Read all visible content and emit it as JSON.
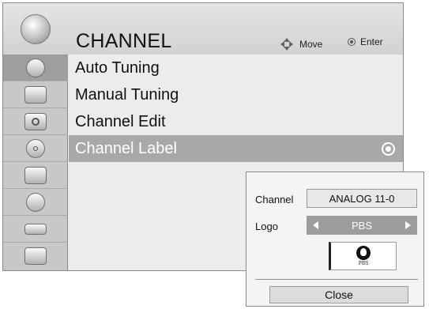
{
  "header": {
    "title": "CHANNEL",
    "logo_icon": "satellite-dish-icon",
    "hints": {
      "move_label": "Move",
      "enter_label": "Enter"
    }
  },
  "sidebar": {
    "items": [
      {
        "icon": "satellite-dish-icon",
        "active": true
      },
      {
        "icon": "tv-screen-icon"
      },
      {
        "icon": "speaker-icon"
      },
      {
        "icon": "clock-icon"
      },
      {
        "icon": "briefcase-icon"
      },
      {
        "icon": "padlock-icon"
      },
      {
        "icon": "cable-plug-icon"
      },
      {
        "icon": "photo-folder-icon"
      }
    ]
  },
  "menu": {
    "items": [
      {
        "label": "Auto Tuning"
      },
      {
        "label": "Manual Tuning"
      },
      {
        "label": "Channel Edit"
      },
      {
        "label": "Channel Label",
        "selected": true
      }
    ]
  },
  "popup": {
    "channel_label": "Channel",
    "channel_value": "ANALOG 11-0",
    "logo_label": "Logo",
    "logo_value": "PBS",
    "logo_preview_text": "PBS",
    "close_label": "Close"
  },
  "colors": {
    "selection": "#a8a8a8",
    "sidebar_bg": "#c8c8c8",
    "header_bg": "#d8d8d8"
  }
}
